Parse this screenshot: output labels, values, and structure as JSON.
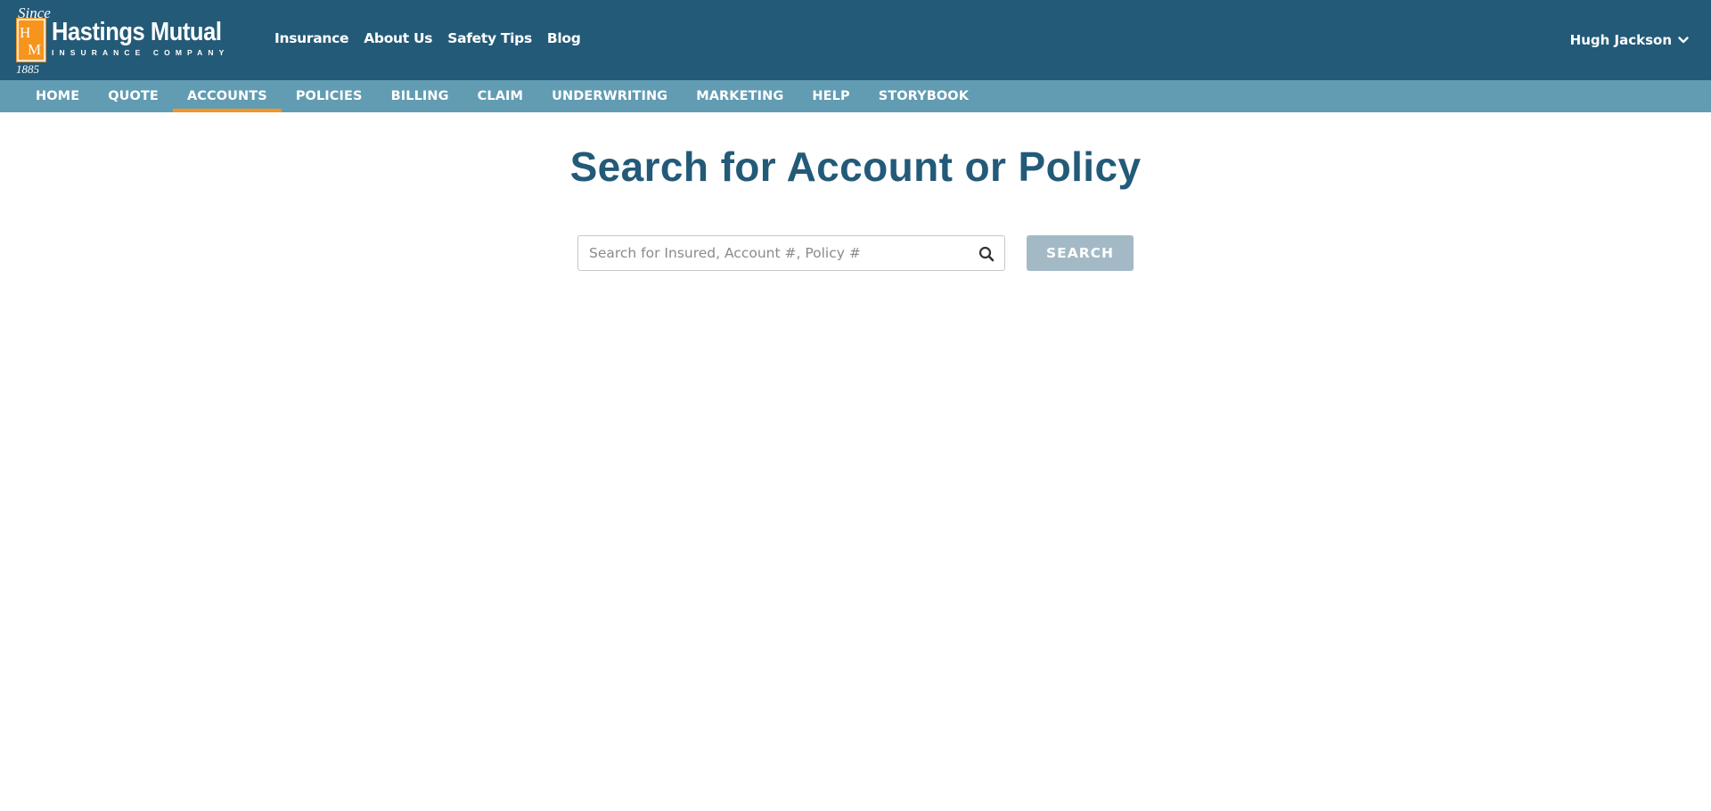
{
  "brand": {
    "name": "Hastings Mutual",
    "subtitle": "INSURANCE COMPANY",
    "mark_top": "Since",
    "mark_letters": "HM",
    "mark_year": "1885",
    "colors": {
      "header": "#235a78",
      "nav": "#629cb3",
      "accent": "#f7941d",
      "logo_orange": "#f7941d"
    }
  },
  "top_nav": {
    "links": [
      {
        "label": "Insurance"
      },
      {
        "label": "About Us"
      },
      {
        "label": "Safety Tips"
      },
      {
        "label": "Blog"
      }
    ]
  },
  "user_menu": {
    "name": "Hugh Jackson",
    "icon": "chevron-down-icon"
  },
  "main_nav": {
    "items": [
      {
        "label": "HOME",
        "active": false
      },
      {
        "label": "QUOTE",
        "active": false
      },
      {
        "label": "ACCOUNTS",
        "active": true
      },
      {
        "label": "POLICIES",
        "active": false
      },
      {
        "label": "BILLING",
        "active": false
      },
      {
        "label": "CLAIM",
        "active": false
      },
      {
        "label": "UNDERWRITING",
        "active": false
      },
      {
        "label": "MARKETING",
        "active": false
      },
      {
        "label": "HELP",
        "active": false
      },
      {
        "label": "STORYBOOK",
        "active": false
      }
    ]
  },
  "main": {
    "title": "Search for Account or Policy",
    "search": {
      "value": "",
      "placeholder": "Search for Insured, Account #, Policy #",
      "icon": "search-icon",
      "button_label": "SEARCH",
      "button_color": "#a3bac6"
    }
  }
}
